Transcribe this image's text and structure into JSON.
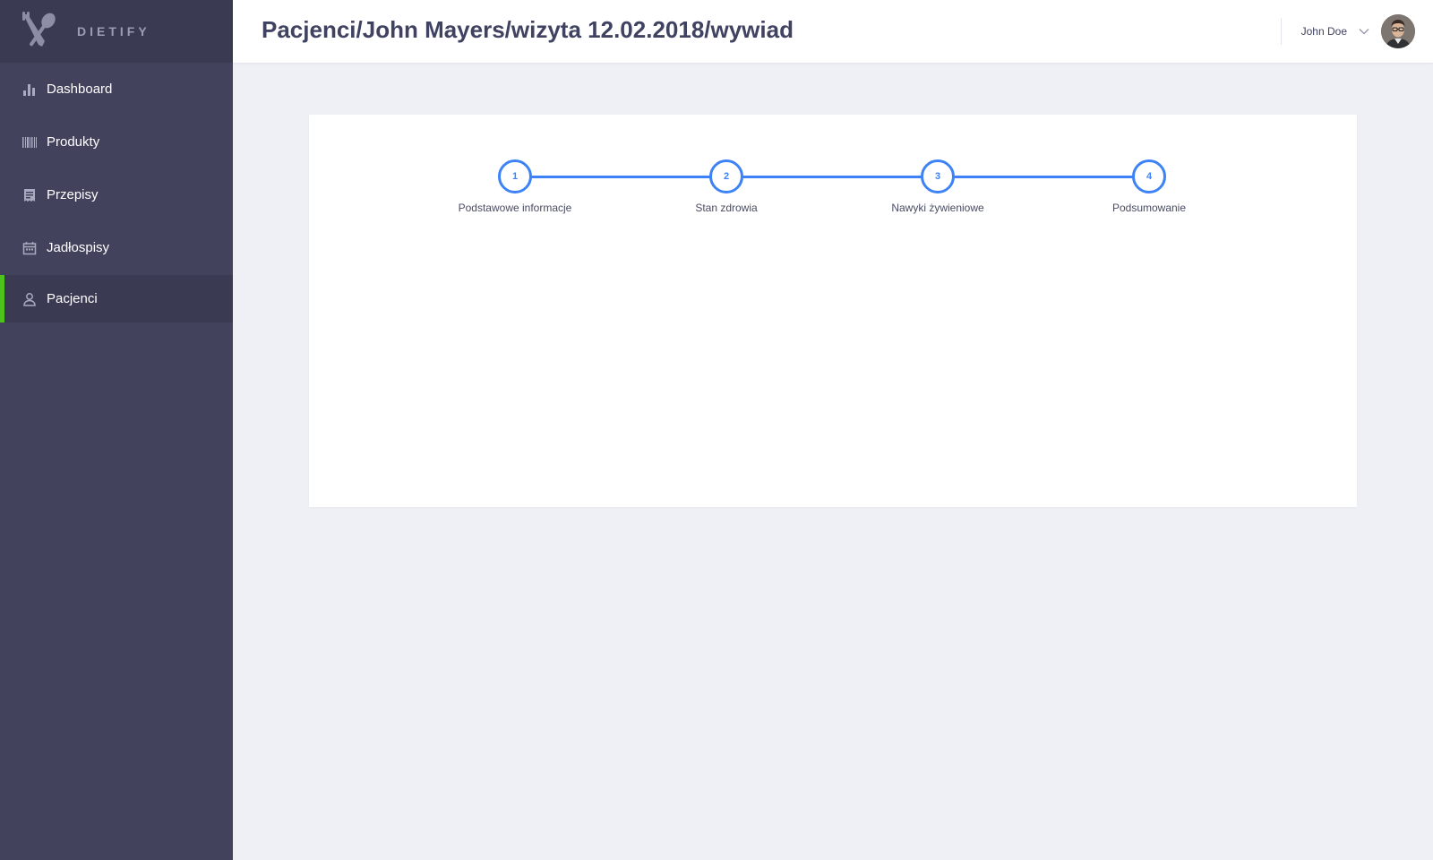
{
  "brand": {
    "name": "DIETIFY",
    "logo_icon": "spoon-knife-icon"
  },
  "sidebar": {
    "items": [
      {
        "label": "Dashboard",
        "icon": "bar-chart-icon",
        "active": false
      },
      {
        "label": "Produkty",
        "icon": "barcode-icon",
        "active": false
      },
      {
        "label": "Przepisy",
        "icon": "receipt-icon",
        "active": false
      },
      {
        "label": "Jadłospisy",
        "icon": "calendar-icon",
        "active": false
      },
      {
        "label": "Pacjenci",
        "icon": "user-icon",
        "active": true
      }
    ]
  },
  "header": {
    "breadcrumb": "Pacjenci/John Mayers/wizyta 12.02.2018/wywiad",
    "user_name": "John Doe"
  },
  "stepper": {
    "steps": [
      {
        "number": "1",
        "label": "Podstawowe informacje"
      },
      {
        "number": "2",
        "label": "Stan zdrowia"
      },
      {
        "number": "3",
        "label": "Nawyki żywieniowe"
      },
      {
        "number": "4",
        "label": "Podsumowanie"
      }
    ]
  },
  "colors": {
    "sidebar_bg": "#42425c",
    "sidebar_active_bg": "#3a3a53",
    "active_indicator": "#4fc31d",
    "accent": "#3d82f6",
    "page_bg": "#eff0f5"
  }
}
